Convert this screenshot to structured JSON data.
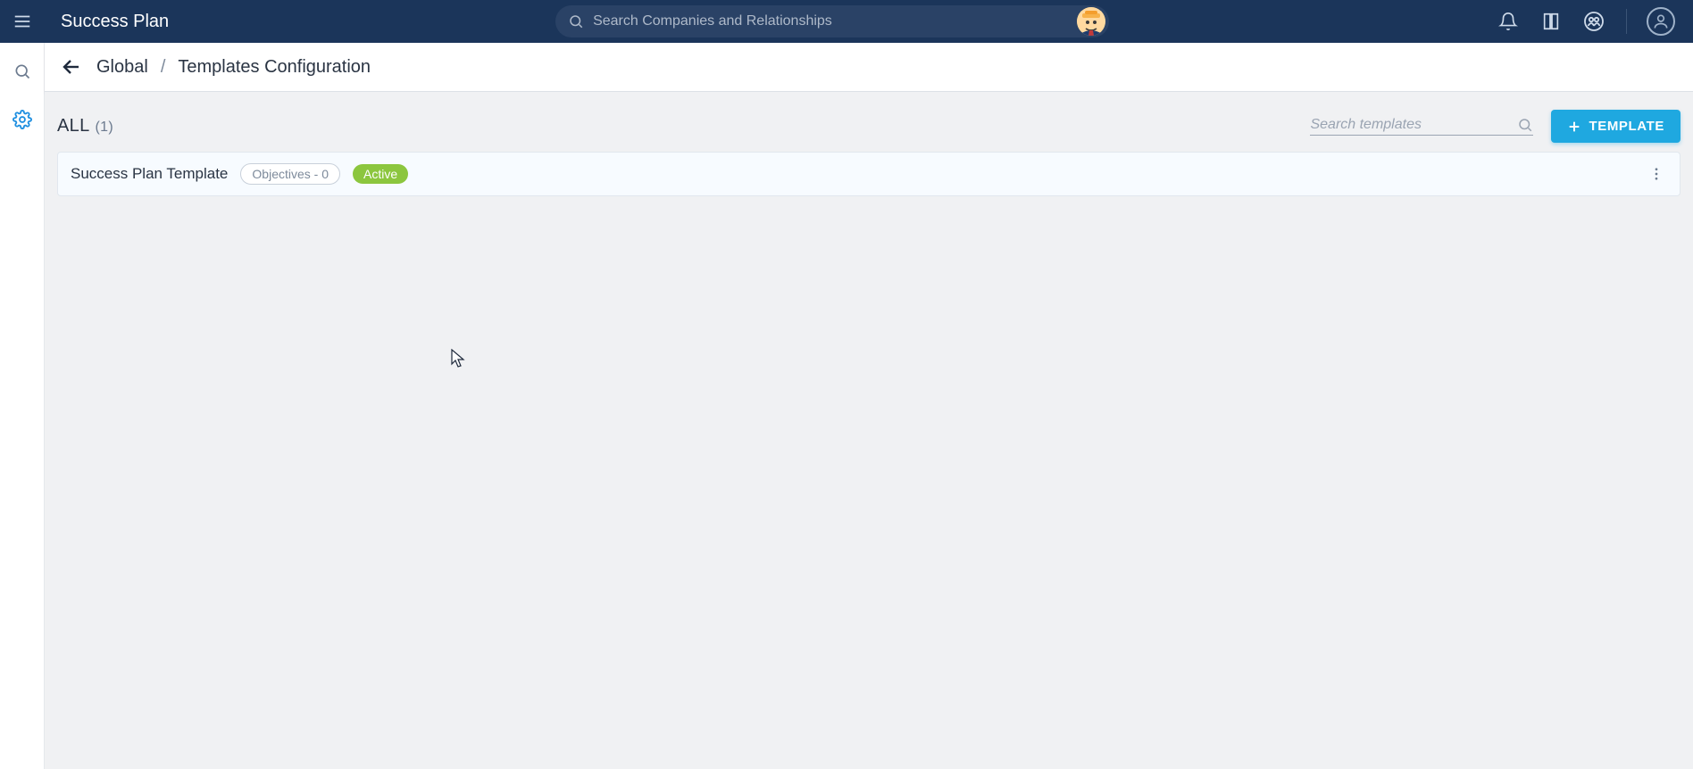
{
  "app_title": "Success Plan",
  "global_search": {
    "placeholder": "Search Companies and Relationships"
  },
  "breadcrumb": {
    "root": "Global",
    "sep": "/",
    "current": "Templates Configuration"
  },
  "section": {
    "label": "ALL",
    "count": "(1)"
  },
  "template_search": {
    "placeholder": "Search templates"
  },
  "add_button": {
    "label": "TEMPLATE"
  },
  "templates": [
    {
      "name": "Success Plan Template",
      "objectives_label": "Objectives - 0",
      "status": "Active"
    }
  ],
  "colors": {
    "navbar": "#1b355a",
    "accent": "#1fa8e0",
    "active_green": "#8cc63e",
    "rail_active": "#1f8fe0"
  }
}
